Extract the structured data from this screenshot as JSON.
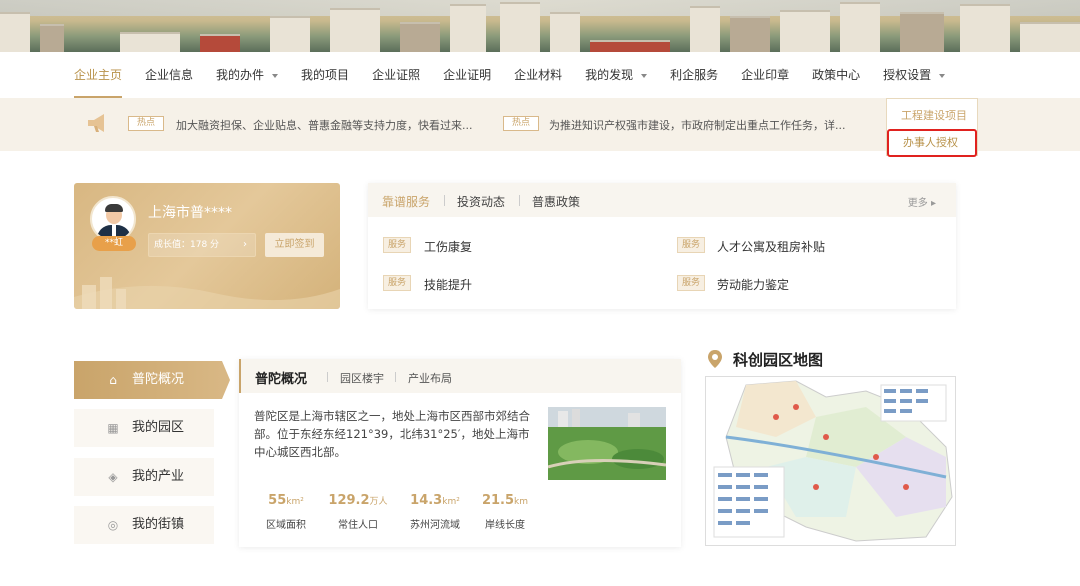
{
  "nav": {
    "items": [
      {
        "label": "企业主页",
        "active": true,
        "caret": false
      },
      {
        "label": "企业信息",
        "active": false,
        "caret": false
      },
      {
        "label": "我的办件",
        "active": false,
        "caret": true
      },
      {
        "label": "我的项目",
        "active": false,
        "caret": false
      },
      {
        "label": "企业证照",
        "active": false,
        "caret": false
      },
      {
        "label": "企业证明",
        "active": false,
        "caret": false
      },
      {
        "label": "企业材料",
        "active": false,
        "caret": false
      },
      {
        "label": "我的发现",
        "active": false,
        "caret": true
      },
      {
        "label": "利企服务",
        "active": false,
        "caret": false
      },
      {
        "label": "企业印章",
        "active": false,
        "caret": false
      },
      {
        "label": "政策中心",
        "active": false,
        "caret": false
      },
      {
        "label": "授权设置",
        "active": false,
        "caret": true
      }
    ],
    "dropdown": {
      "items": [
        "工程建设项目",
        "办事人授权"
      ],
      "selected_index": 1
    }
  },
  "hot": {
    "tag": "热点",
    "items": [
      "加大融资担保、企业贴息、普惠金融等支持力度，快看过来...",
      "为推进知识产权强市建设，市政府制定出重点工作任务，详..."
    ]
  },
  "user": {
    "name": "上海市普****",
    "badge": "**虹",
    "growth": "成长值：178 分",
    "sign_label": "立即签到"
  },
  "services": {
    "tabs": [
      "靠谱服务",
      "投资动态",
      "普惠政策"
    ],
    "more": "更多",
    "tag": "服务",
    "items": [
      "工伤康复",
      "人才公寓及租房补贴",
      "技能提升",
      "劳动能力鉴定"
    ]
  },
  "left_menu": {
    "items": [
      {
        "label": "普陀概况",
        "icon": "home-icon",
        "active": true
      },
      {
        "label": "我的园区",
        "icon": "building-icon",
        "active": false
      },
      {
        "label": "我的产业",
        "icon": "layers-icon",
        "active": false
      },
      {
        "label": "我的街镇",
        "icon": "location-icon",
        "active": false
      }
    ]
  },
  "overview": {
    "title": "普陀概况",
    "tabs": [
      "园区楼宇",
      "产业布局"
    ],
    "description": "普陀区是上海市辖区之一，地处上海市区西部市郊结合部。位于东经东经121°39，北纬31°25′，地处上海市中心城区西北部。",
    "stats": [
      {
        "value": "55",
        "unit": "km²",
        "label": "区域面积"
      },
      {
        "value": "129.2",
        "unit": "万人",
        "label": "常住人口"
      },
      {
        "value": "14.3",
        "unit": "km²",
        "label": "苏州河流域"
      },
      {
        "value": "21.5",
        "unit": "km",
        "label": "岸线长度"
      }
    ]
  },
  "map": {
    "title": "科创园区地图"
  },
  "colors": {
    "accent": "#c9a46a",
    "highlight_box": "#e0221f"
  }
}
